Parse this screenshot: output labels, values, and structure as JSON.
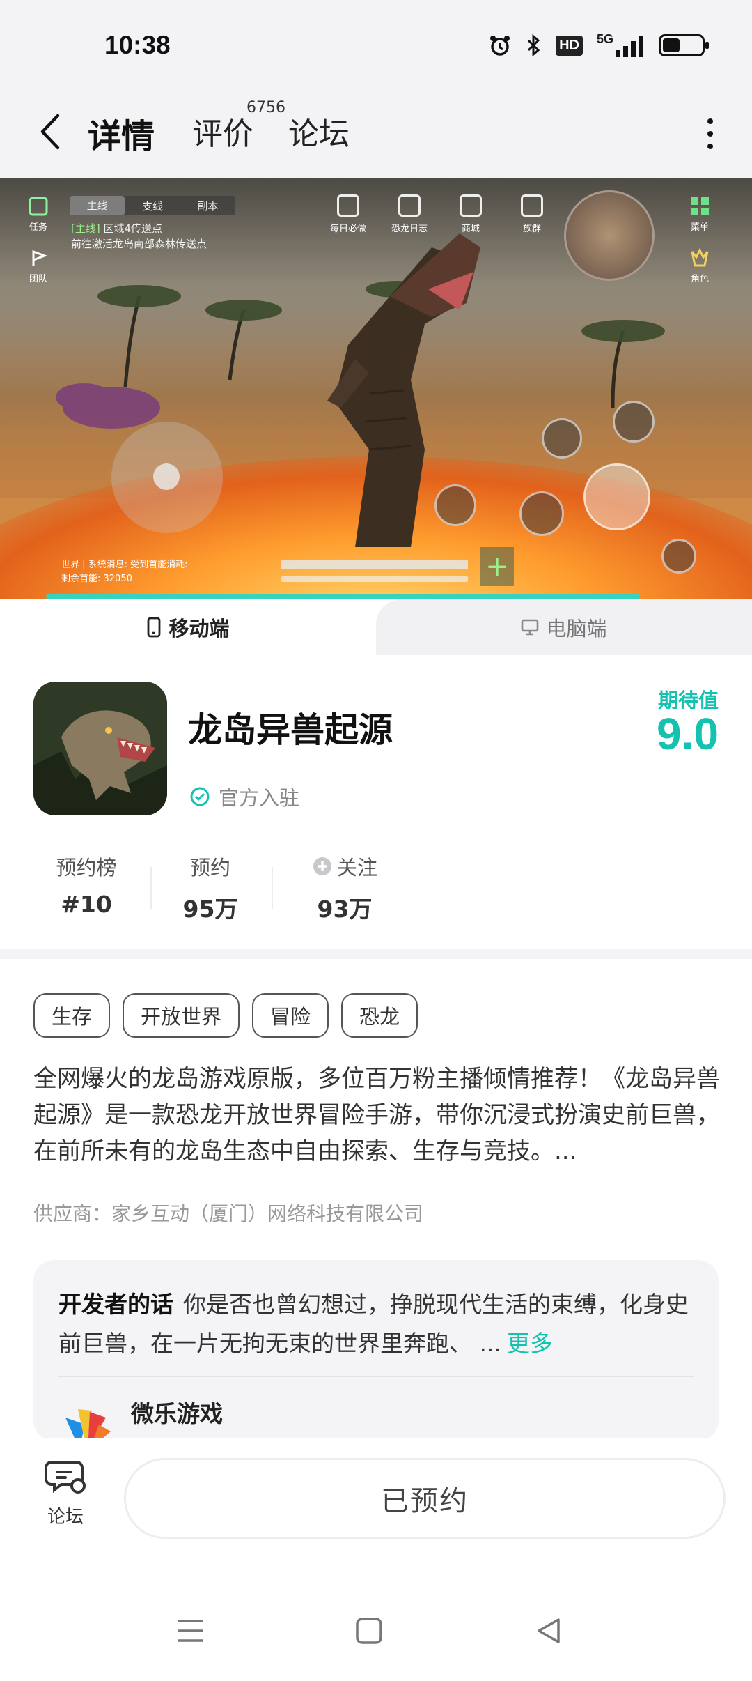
{
  "status_bar": {
    "time": "10:38",
    "hd_label": "HD",
    "network_label": "5G",
    "battery_level": 0.45,
    "icons": [
      "alarm-icon",
      "bluetooth-icon",
      "hd-badge",
      "5g-signal-icon",
      "battery-icon"
    ]
  },
  "header": {
    "tabs": [
      {
        "label": "详情",
        "active": true
      },
      {
        "label": "评价",
        "active": false
      },
      {
        "label": "论坛",
        "active": false
      }
    ],
    "review_count": "6756",
    "icons": [
      "back-arrow-icon",
      "more-vertical-icon"
    ]
  },
  "hero": {
    "video_progress": 0.9,
    "hud_tabs": [
      "主线",
      "支线",
      "副本"
    ],
    "quest_tag": "[主线]",
    "quest_line1": "区域4传送点",
    "quest_line2": "前往激活龙岛南部森林传送点",
    "hud_menu": [
      "每日必做",
      "恐龙日志",
      "商城",
      "族群"
    ],
    "chat_line1": "世界 | 系统消息: 受到首能消耗:",
    "chat_line2": "剩余首能: 32050",
    "hud_left": [
      "任务",
      "团队"
    ],
    "hud_right": [
      "菜单",
      "角色"
    ]
  },
  "platform_tabs": {
    "mobile_label": "移动端",
    "pc_label": "电脑端",
    "active": "mobile"
  },
  "game": {
    "title": "龙岛异兽起源",
    "verified_label": "官方入驻",
    "expect_label": "期待值",
    "expect_score": "9.0"
  },
  "stats": [
    {
      "label": "预约榜",
      "value": "#10"
    },
    {
      "label": "预约",
      "value": "95万"
    },
    {
      "label": "关注",
      "value": "93万"
    }
  ],
  "tags": [
    "生存",
    "开放世界",
    "冒险",
    "恐龙"
  ],
  "description": "全网爆火的龙岛游戏原版，多位百万粉主播倾情推荐！《龙岛异兽起源》是一款恐龙开放世界冒险手游，带你沉浸式扮演史前巨兽，在前所未有的龙岛生态中自由探索、生存与竞技。...",
  "supplier": "供应商：家乡互动（厦门）网络科技有限公司",
  "developer": {
    "label": "开发者的话",
    "text": "你是否也曾幻想过，挣脱现代生活的束缚，化身史前巨兽，在一片无拘无束的世界里奔跑、 ...",
    "more_label": "更多",
    "publisher_name": "微乐游戏"
  },
  "action_bar": {
    "forum_label": "论坛",
    "reserve_label": "已预约"
  },
  "colors": {
    "accent": "#15c2b0",
    "tab_underline": "#2cd4c4",
    "background": "#ffffff",
    "header_bg": "#f3f3f5"
  }
}
